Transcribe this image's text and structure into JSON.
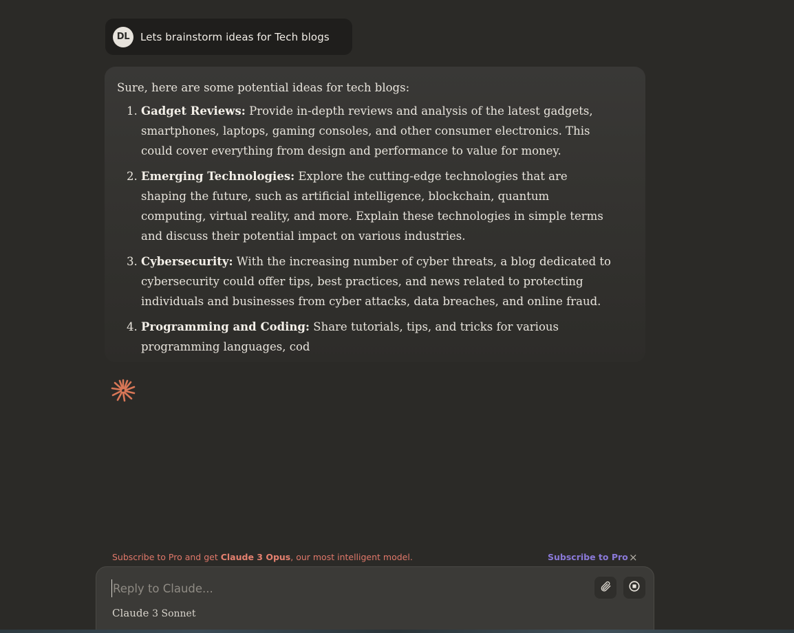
{
  "user_message": {
    "avatar_initials": "DL",
    "text": "Lets brainstorm ideas for Tech blogs"
  },
  "assistant_message": {
    "intro": "Sure, here are some potential ideas for tech blogs:",
    "items": [
      {
        "title": "Gadget Reviews:",
        "body": " Provide in-depth reviews and analysis of the latest gadgets, smartphones, laptops, gaming consoles, and other consumer electronics. This could cover everything from design and performance to value for money."
      },
      {
        "title": "Emerging Technologies:",
        "body": " Explore the cutting-edge technologies that are shaping the future, such as artificial intelligence, blockchain, quantum computing, virtual reality, and more. Explain these technologies in simple terms and discuss their potential impact on various industries."
      },
      {
        "title": "Cybersecurity:",
        "body": " With the increasing number of cyber threats, a blog dedicated to cybersecurity could offer tips, best practices, and news related to protecting individuals and businesses from cyber attacks, data breaches, and online fraud."
      },
      {
        "title": "Programming and Coding:",
        "body": " Share tutorials, tips, and tricks for various programming languages, cod"
      }
    ],
    "streaming_icon": "claude-spark-icon"
  },
  "banner": {
    "prefix": "Subscribe to Pro and get ",
    "highlight": "Claude 3 Opus",
    "suffix": ", our most intelligent model.",
    "link_label": "Subscribe to Pro",
    "close_label": "×"
  },
  "composer": {
    "placeholder": "Reply to Claude...",
    "value": "",
    "model_name": "Claude",
    "model_version": "3 Sonnet",
    "attach_icon": "paperclip-icon",
    "stop_icon": "stop-icon"
  },
  "colors": {
    "background": "#2b2a27",
    "accent_orange": "#d97757",
    "link_purple": "#8a79d8",
    "banner_text": "#e0786a"
  }
}
